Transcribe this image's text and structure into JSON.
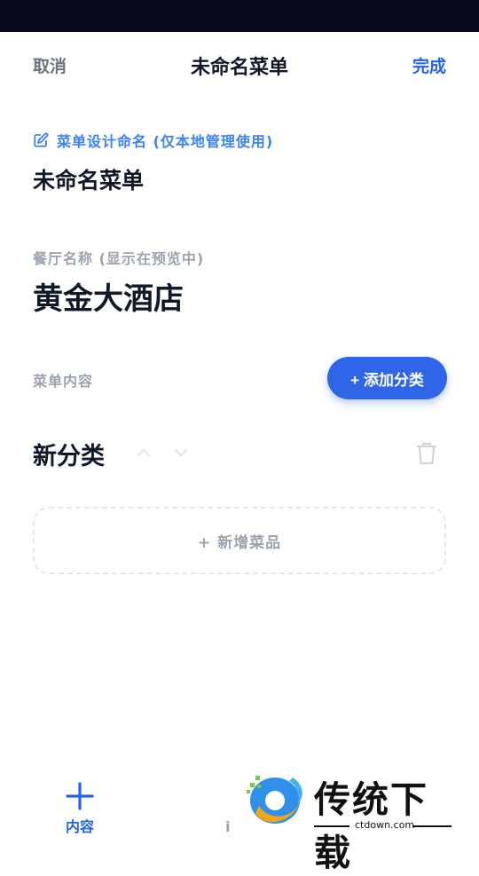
{
  "header": {
    "cancel": "取消",
    "title": "未命名菜单",
    "done": "完成"
  },
  "design": {
    "label": "菜单设计命名 (仅本地管理使用)",
    "value": "未命名菜单",
    "icon": "edit-icon"
  },
  "restaurant": {
    "label": "餐厅名称 (显示在预览中)",
    "value": "黄金大酒店"
  },
  "content": {
    "label": "菜单内容",
    "add_category": "+ 添加分类"
  },
  "category": {
    "name": "新分类",
    "add_dish": "+ 新增菜品"
  },
  "nav": {
    "content_label": "内容",
    "partial_label": "i"
  },
  "watermark": {
    "text": "传统下载",
    "url": "ctdown.com"
  },
  "colors": {
    "accent": "#2563eb",
    "button": "#2f66e8",
    "status_bar": "#060a1c",
    "muted": "#9ca3af"
  }
}
